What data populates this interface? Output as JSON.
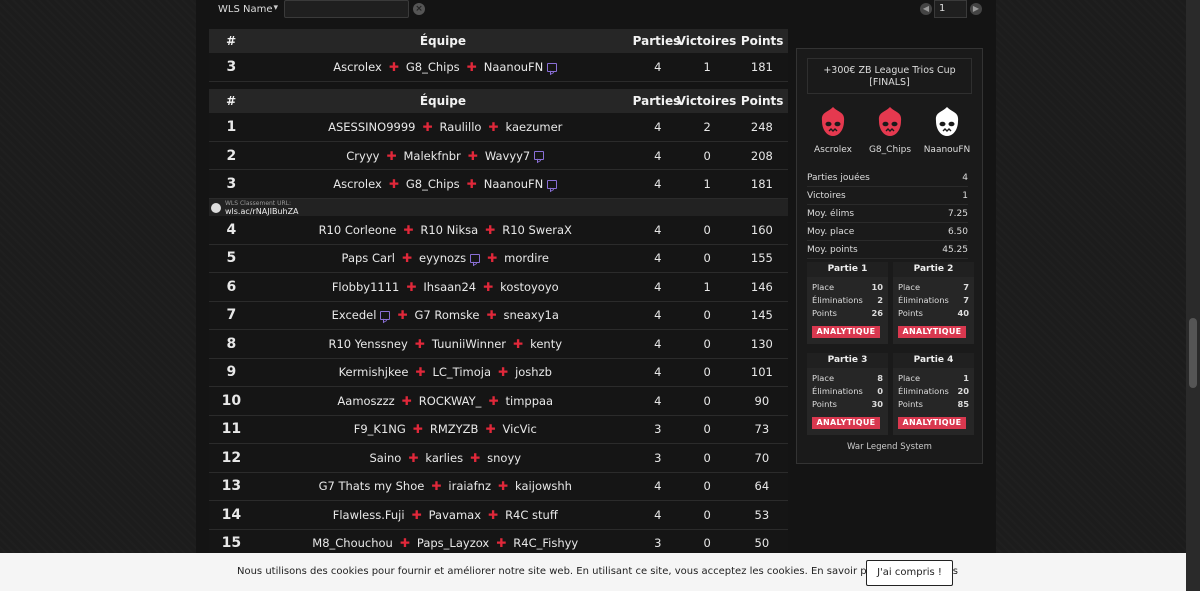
{
  "filter": {
    "select_value": "WLS Name",
    "search_value": ""
  },
  "pager": {
    "page": "1"
  },
  "table_headers": {
    "rank": "#",
    "team": "Équipe",
    "parties": "Parties",
    "victoires": "Victoires",
    "points": "Points"
  },
  "highlight_row": {
    "rank": "3",
    "players": [
      {
        "name": "Ascrolex"
      },
      {
        "name": "G8_Chips"
      },
      {
        "name": "NaanouFN",
        "twitch": true
      }
    ],
    "parties": "4",
    "victoires": "1",
    "points": "181"
  },
  "url_bar": {
    "label": "WLS Classement URL:",
    "value": "wls.ac/rNAJIBuhZA"
  },
  "rows": [
    {
      "rank": "1",
      "players": [
        {
          "name": "ASESSINO9999"
        },
        {
          "name": "Raulillo"
        },
        {
          "name": "kaezumer"
        }
      ],
      "parties": "4",
      "victoires": "2",
      "points": "248"
    },
    {
      "rank": "2",
      "players": [
        {
          "name": "Cryyy"
        },
        {
          "name": "Malekfnbr"
        },
        {
          "name": "Wavyy7",
          "twitch": true
        }
      ],
      "parties": "4",
      "victoires": "0",
      "points": "208"
    },
    {
      "rank": "3",
      "players": [
        {
          "name": "Ascrolex"
        },
        {
          "name": "G8_Chips"
        },
        {
          "name": "NaanouFN",
          "twitch": true
        }
      ],
      "parties": "4",
      "victoires": "1",
      "points": "181"
    },
    {
      "rank": "4",
      "players": [
        {
          "name": "R10 Corleone"
        },
        {
          "name": "R10 Niksa"
        },
        {
          "name": "R10 SweraX"
        }
      ],
      "parties": "4",
      "victoires": "0",
      "points": "160"
    },
    {
      "rank": "5",
      "players": [
        {
          "name": "Paps Carl"
        },
        {
          "name": "eyynozs",
          "twitch": true
        },
        {
          "name": "mordire"
        }
      ],
      "parties": "4",
      "victoires": "0",
      "points": "155"
    },
    {
      "rank": "6",
      "players": [
        {
          "name": "Flobby1111"
        },
        {
          "name": "Ihsaan24"
        },
        {
          "name": "kostoyoyo"
        }
      ],
      "parties": "4",
      "victoires": "1",
      "points": "146"
    },
    {
      "rank": "7",
      "players": [
        {
          "name": "Excedel",
          "twitch": true
        },
        {
          "name": "G7 Romske"
        },
        {
          "name": "sneaxy1a"
        }
      ],
      "parties": "4",
      "victoires": "0",
      "points": "145"
    },
    {
      "rank": "8",
      "players": [
        {
          "name": "R10 Yenssney"
        },
        {
          "name": "TuuniiWinner"
        },
        {
          "name": "kenty"
        }
      ],
      "parties": "4",
      "victoires": "0",
      "points": "130"
    },
    {
      "rank": "9",
      "players": [
        {
          "name": "Kermishjkee"
        },
        {
          "name": "LC_Timoja"
        },
        {
          "name": "joshzb"
        }
      ],
      "parties": "4",
      "victoires": "0",
      "points": "101"
    },
    {
      "rank": "10",
      "players": [
        {
          "name": "Aamoszzz"
        },
        {
          "name": "ROCKWAY_"
        },
        {
          "name": "timppaa"
        }
      ],
      "parties": "4",
      "victoires": "0",
      "points": "90"
    },
    {
      "rank": "11",
      "players": [
        {
          "name": "F9_K1NG"
        },
        {
          "name": "RMZYZB"
        },
        {
          "name": "VicVic"
        }
      ],
      "parties": "3",
      "victoires": "0",
      "points": "73"
    },
    {
      "rank": "12",
      "players": [
        {
          "name": "Saino"
        },
        {
          "name": "karlies"
        },
        {
          "name": "snoyy"
        }
      ],
      "parties": "3",
      "victoires": "0",
      "points": "70"
    },
    {
      "rank": "13",
      "players": [
        {
          "name": "G7 Thats my Shoe"
        },
        {
          "name": "iraiafnz"
        },
        {
          "name": "kaijowshh"
        }
      ],
      "parties": "4",
      "victoires": "0",
      "points": "64"
    },
    {
      "rank": "14",
      "players": [
        {
          "name": "Flawless.Fuji"
        },
        {
          "name": "Pavamax"
        },
        {
          "name": "R4C stuff"
        }
      ],
      "parties": "4",
      "victoires": "0",
      "points": "53"
    },
    {
      "rank": "15",
      "players": [
        {
          "name": "M8_Chouchou"
        },
        {
          "name": "Paps_Layzox"
        },
        {
          "name": "R4C_Fishyy"
        }
      ],
      "parties": "3",
      "victoires": "0",
      "points": "50"
    }
  ],
  "panel": {
    "title": "+300€ ZB League Trios Cup [FINALS]",
    "players": [
      {
        "name": "Ascrolex",
        "avatar_color": "#e5394f"
      },
      {
        "name": "G8_Chips",
        "avatar_color": "#e5394f"
      },
      {
        "name": "NaanouFN",
        "avatar_color": "#ffffff"
      }
    ],
    "stats": [
      {
        "label": "Parties jouées",
        "value": "4"
      },
      {
        "label": "Victoires",
        "value": "1"
      },
      {
        "label": "Moy. élims",
        "value": "7.25"
      },
      {
        "label": "Moy. place",
        "value": "6.50"
      },
      {
        "label": "Moy. points",
        "value": "45.25"
      }
    ],
    "games": [
      {
        "title": "Partie 1",
        "place_label": "Place",
        "place": "10",
        "elim_label": "Éliminations",
        "elims": "2",
        "points_label": "Points",
        "points": "26",
        "button": "ANALYTIQUE"
      },
      {
        "title": "Partie 2",
        "place_label": "Place",
        "place": "7",
        "elim_label": "Éliminations",
        "elims": "7",
        "points_label": "Points",
        "points": "40",
        "button": "ANALYTIQUE"
      },
      {
        "title": "Partie 3",
        "place_label": "Place",
        "place": "8",
        "elim_label": "Éliminations",
        "elims": "0",
        "points_label": "Points",
        "points": "30",
        "button": "ANALYTIQUE"
      },
      {
        "title": "Partie 4",
        "place_label": "Place",
        "place": "1",
        "elim_label": "Éliminations",
        "elims": "20",
        "points_label": "Points",
        "points": "85",
        "button": "ANALYTIQUE"
      }
    ],
    "footer": "War Legend System"
  },
  "cookie": {
    "text": "Nous utilisons des cookies pour fournir et améliorer notre site web. En utilisant ce site, vous acceptez les cookies. En savoir plus sur les cookies",
    "button": "J'ai compris !"
  },
  "colors": {
    "accent": "#e0283a",
    "button": "#d9384f",
    "twitch": "#8a6fd6"
  }
}
